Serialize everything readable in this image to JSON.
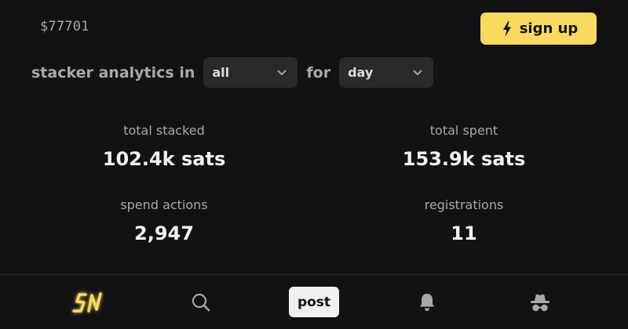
{
  "header": {
    "price": "$77701",
    "signup_label": "sign up",
    "signup_icon": "bolt-icon"
  },
  "filters": {
    "prefix": "stacker analytics in",
    "sub_select": {
      "value": "all"
    },
    "connector": "for",
    "period_select": {
      "value": "day"
    }
  },
  "stats": [
    {
      "label": "total stacked",
      "value": "102.4k sats"
    },
    {
      "label": "total spent",
      "value": "153.9k sats"
    },
    {
      "label": "spend actions",
      "value": "2,947"
    },
    {
      "label": "registrations",
      "value": "11"
    }
  ],
  "bottom_nav": {
    "logo_icon": "sn-logo-icon",
    "search_icon": "search-icon",
    "post_label": "post",
    "notifications_icon": "bell-icon",
    "anon_icon": "anon-hat-icon"
  },
  "colors": {
    "background": "#121214",
    "accent": "#fada5e",
    "muted_text": "#a8a8a8",
    "select_bg": "#2a2a2c"
  }
}
